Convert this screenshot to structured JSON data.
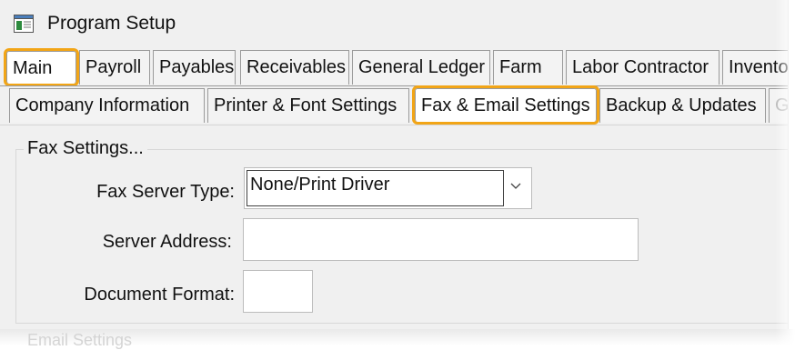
{
  "window": {
    "title": "Program Setup"
  },
  "main_tabs": [
    {
      "label": "Main"
    },
    {
      "label": "Payroll"
    },
    {
      "label": "Payables"
    },
    {
      "label": "Receivables"
    },
    {
      "label": "General Ledger"
    },
    {
      "label": "Farm"
    },
    {
      "label": "Labor Contractor"
    },
    {
      "label": "Invento"
    }
  ],
  "sub_tabs": [
    {
      "label": "Company Information"
    },
    {
      "label": "Printer & Font Settings"
    },
    {
      "label": "Fax & Email Settings"
    },
    {
      "label": "Backup & Updates"
    },
    {
      "label": "G"
    }
  ],
  "fax_settings": {
    "title": "Fax Settings...",
    "server_type_label": "Fax Server Type:",
    "server_type_value": "None/Print Driver",
    "server_address_label": "Server Address:",
    "server_address_value": "",
    "document_format_label": "Document Format:",
    "document_format_value": ""
  },
  "next_group_title": "Email Settings",
  "colors": {
    "highlight": "#f2a516"
  }
}
